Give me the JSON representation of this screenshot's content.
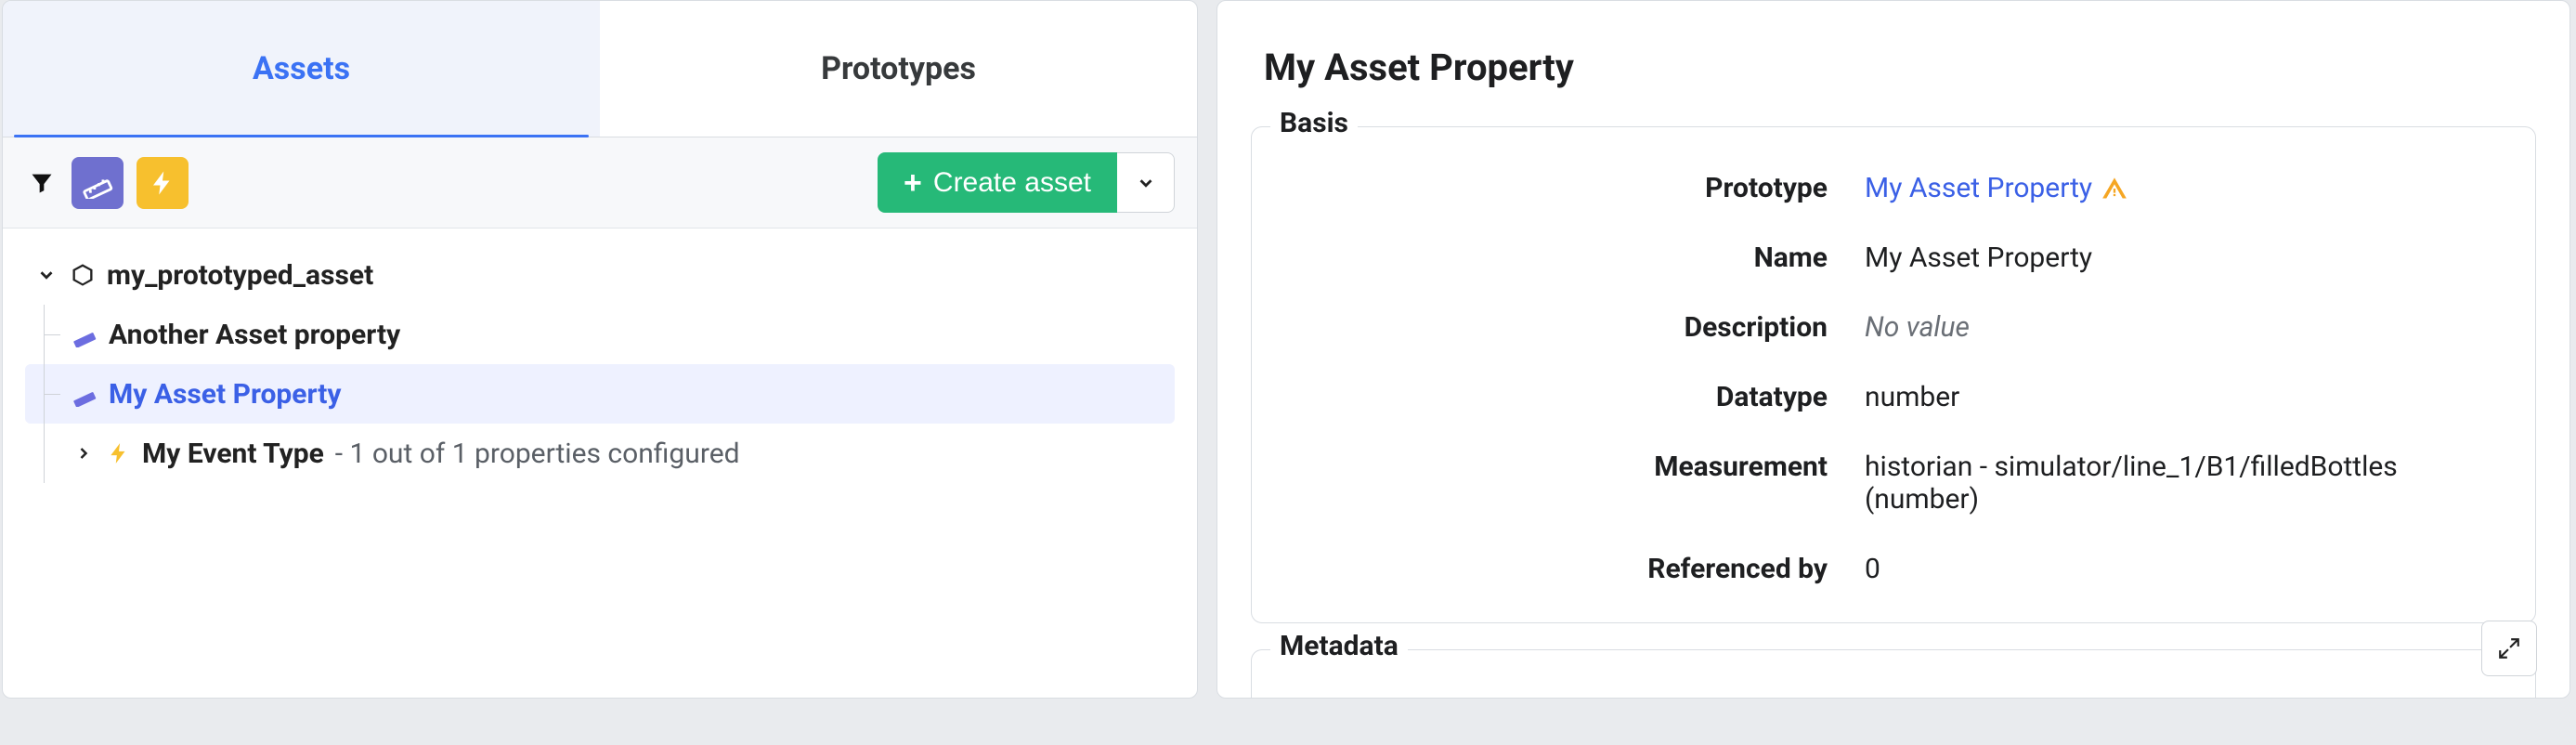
{
  "tabs": {
    "assets": "Assets",
    "prototypes": "Prototypes"
  },
  "toolbar": {
    "create_label": "Create asset"
  },
  "tree": {
    "root_label": "my_prototyped_asset",
    "items": [
      {
        "label": "Another Asset property"
      },
      {
        "label": "My Asset Property"
      },
      {
        "label_bold": "My Event Type",
        "label_suffix": " - 1 out of 1 properties configured"
      }
    ]
  },
  "details": {
    "title": "My Asset Property",
    "basis_legend": "Basis",
    "metadata_legend": "Metadata",
    "fields": {
      "prototype_label": "Prototype",
      "prototype_value": "My Asset Property",
      "name_label": "Name",
      "name_value": "My Asset Property",
      "description_label": "Description",
      "description_value": "No value",
      "datatype_label": "Datatype",
      "datatype_value": "number",
      "measurement_label": "Measurement",
      "measurement_value": "historian - simulator/line_1/B1/filledBottles (number)",
      "referencedby_label": "Referenced by",
      "referencedby_value": "0"
    }
  }
}
